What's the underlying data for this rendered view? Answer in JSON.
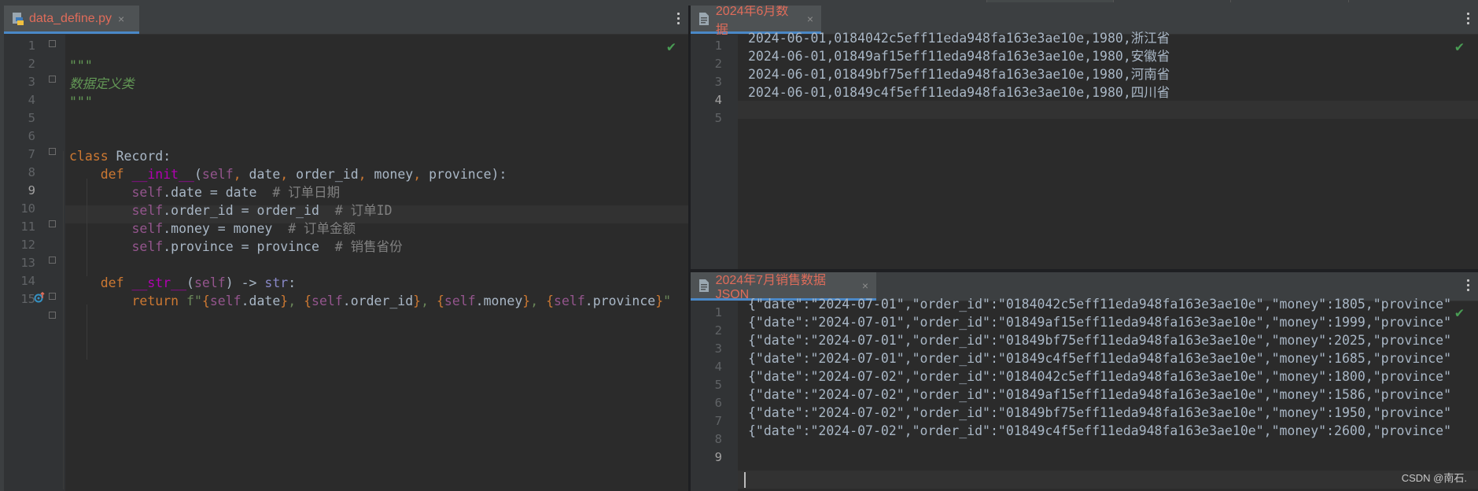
{
  "left_editor": {
    "tab_label": "data_define.py",
    "tab_close": "×",
    "line_numbers": [
      "1",
      "2",
      "3",
      "4",
      "5",
      "6",
      "7",
      "8",
      "9",
      "10",
      "11",
      "12",
      "13",
      "14",
      "15"
    ],
    "current_line": "9"
  },
  "right_top_editor": {
    "tab_label": "2024年6月数据",
    "tab_close": "×",
    "line_numbers": [
      "1",
      "2",
      "3",
      "4",
      "5"
    ],
    "current_line": "4",
    "lines": [
      "2024-06-01,0184042c5eff11eda948fa163e3ae10e,1980,浙江省",
      "2024-06-01,01849af15eff11eda948fa163e3ae10e,1980,安徽省",
      "2024-06-01,01849bf75eff11eda948fa163e3ae10e,1980,河南省",
      "2024-06-01,01849c4f5eff11eda948fa163e3ae10e,1980,四川省",
      ""
    ]
  },
  "right_bottom_editor": {
    "tab_label": "2024年7月销售数据JSON",
    "tab_close": "×",
    "line_numbers": [
      "1",
      "2",
      "3",
      "4",
      "5",
      "6",
      "7",
      "8",
      "9"
    ],
    "current_line": "9",
    "lines": [
      "{\"date\":\"2024-07-01\",\"order_id\":\"0184042c5eff11eda948fa163e3ae10e\",\"money\":1805,\"province\"",
      "{\"date\":\"2024-07-01\",\"order_id\":\"01849af15eff11eda948fa163e3ae10e\",\"money\":1999,\"province\":\"安",
      "{\"date\":\"2024-07-01\",\"order_id\":\"01849bf75eff11eda948fa163e3ae10e\",\"money\":2025,\"province\":\"河",
      "{\"date\":\"2024-07-01\",\"order_id\":\"01849c4f5eff11eda948fa163e3ae10e\",\"money\":1685,\"province\":\"四",
      "{\"date\":\"2024-07-02\",\"order_id\":\"0184042c5eff11eda948fa163e3ae10e\",\"money\":1800,\"province\":\"浙",
      "{\"date\":\"2024-07-02\",\"order_id\":\"01849af15eff11eda948fa163e3ae10e\",\"money\":1586,\"province\":\"安",
      "{\"date\":\"2024-07-02\",\"order_id\":\"01849bf75eff11eda948fa163e3ae10e\",\"money\":1950,\"province\":\"河",
      "{\"date\":\"2024-07-02\",\"order_id\":\"01849c4f5eff11eda948fa163e3ae10e\",\"money\":2600,\"province\":\"四",
      ""
    ]
  },
  "watermark": "CSDN @南石.",
  "icons": {
    "python_file": "python-file-icon",
    "text_file": "text-file-icon",
    "more": "more-vertical-icon",
    "check": "check-icon",
    "override": "override-method-icon"
  },
  "colors": {
    "keyword": "#cc7832",
    "self": "#94558d",
    "magic": "#b200b2",
    "string": "#6a8759",
    "comment": "#808080",
    "check": "#499c54",
    "tab_text": "#e06c5a"
  }
}
